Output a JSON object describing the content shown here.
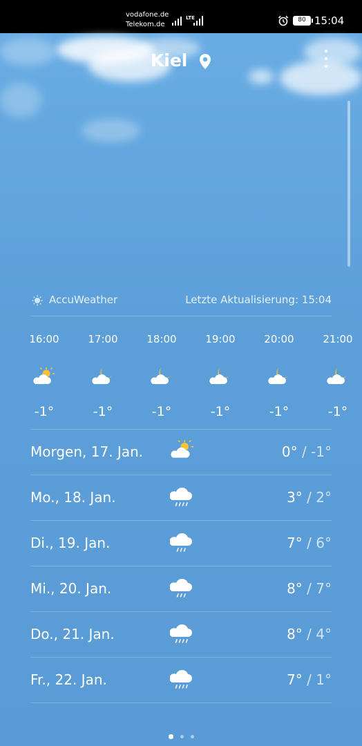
{
  "status_bar": {
    "carrier1": "vodafone.de",
    "carrier2": "Telekom.de",
    "network": "LTE",
    "battery": "80",
    "time": "15:04"
  },
  "header": {
    "city": "Kiel",
    "location_icon": "location-pin-icon",
    "menu_icon": "more-vertical-icon"
  },
  "source": {
    "icon": "sun-icon",
    "name": "AccuWeather",
    "updated": "Letzte Aktualisierung: 15:04"
  },
  "hourly": [
    {
      "time": "16:00",
      "icon": "partly-sunny-icon",
      "temp": "-1°"
    },
    {
      "time": "17:00",
      "icon": "partly-cloudy-night-icon",
      "temp": "-1°"
    },
    {
      "time": "18:00",
      "icon": "partly-cloudy-night-icon",
      "temp": "-1°"
    },
    {
      "time": "19:00",
      "icon": "partly-cloudy-night-icon",
      "temp": "-1°"
    },
    {
      "time": "20:00",
      "icon": "partly-cloudy-night-icon",
      "temp": "-1°"
    },
    {
      "time": "21:00",
      "icon": "partly-cloudy-night-icon",
      "temp": "-1°"
    }
  ],
  "daily": [
    {
      "label": "Morgen, 17. Jan.",
      "icon": "partly-sunny-icon",
      "high": "0°",
      "low": "-1°"
    },
    {
      "label": "Mo., 18. Jan.",
      "icon": "rain-icon",
      "high": "3°",
      "low": "2°"
    },
    {
      "label": "Di., 19. Jan.",
      "icon": "rain-icon",
      "high": "7°",
      "low": "6°"
    },
    {
      "label": "Mi., 20. Jan.",
      "icon": "rain-icon",
      "high": "8°",
      "low": "7°"
    },
    {
      "label": "Do., 21. Jan.",
      "icon": "rain-icon",
      "high": "8°",
      "low": "4°"
    },
    {
      "label": "Fr., 22. Jan.",
      "icon": "rain-icon",
      "high": "7°",
      "low": "1°"
    }
  ],
  "pager": {
    "count": 3,
    "active": 0
  },
  "low_separator": " / "
}
